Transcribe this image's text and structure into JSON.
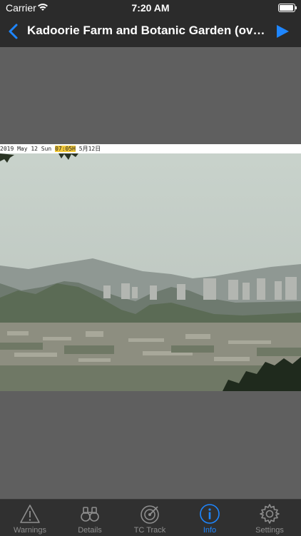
{
  "status_bar": {
    "carrier": "Carrier",
    "time": "7:20 AM"
  },
  "nav": {
    "title": "Kadoorie Farm and Botanic Garden (ov…",
    "back_icon": "chevron-left-icon",
    "forward_icon": "play-forward-icon"
  },
  "webcam": {
    "stamp_date": "2019 May 12 Sun ",
    "stamp_time": "07:05H",
    "stamp_cjk": " 5月12日"
  },
  "tabs": [
    {
      "label": "Warnings",
      "icon": "warning-triangle-icon",
      "active": false
    },
    {
      "label": "Details",
      "icon": "binoculars-icon",
      "active": false
    },
    {
      "label": "TC Track",
      "icon": "radar-icon",
      "active": false
    },
    {
      "label": "Info",
      "icon": "info-circle-icon",
      "active": true
    },
    {
      "label": "Settings",
      "icon": "gear-icon",
      "active": false
    }
  ],
  "colors": {
    "accent": "#1e86ff",
    "bar_bg": "#2b2b2b",
    "content_bg": "#5f5f5f",
    "inactive": "#8e8e8e"
  }
}
